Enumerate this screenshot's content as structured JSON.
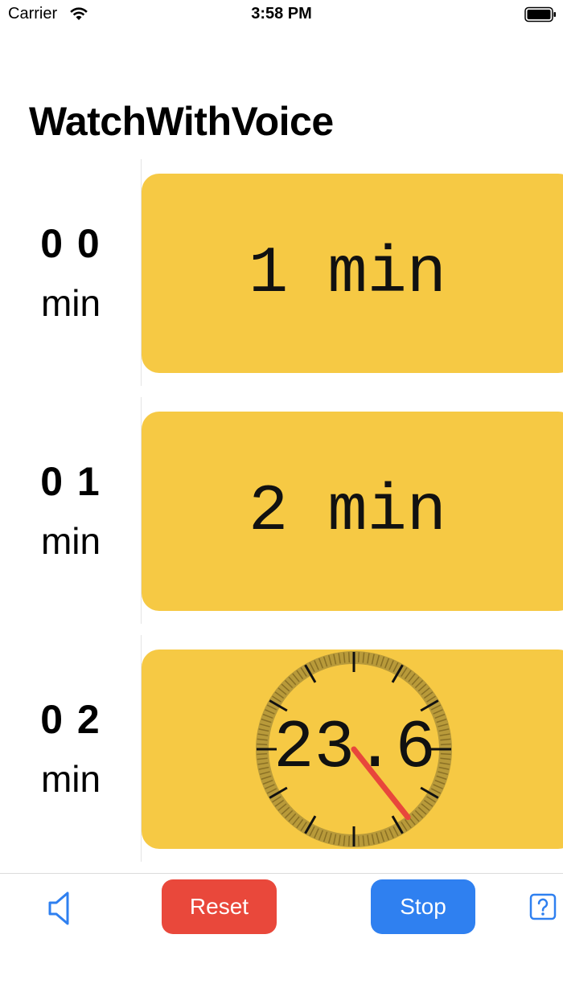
{
  "status_bar": {
    "carrier": "Carrier",
    "time": "3:58 PM",
    "wifi_icon": "wifi-icon",
    "battery_icon": "battery-icon"
  },
  "app": {
    "title": "WatchWithVoice"
  },
  "rows": [
    {
      "number": "0 0",
      "unit": "min",
      "tile_label": "1 min"
    },
    {
      "number": "0 1",
      "unit": "min",
      "tile_label": "2 min"
    },
    {
      "number": "0 2",
      "unit": "min",
      "tile_readout": "23.6"
    }
  ],
  "dial": {
    "seconds": 23.6
  },
  "toolbar": {
    "sound_icon": "speaker-icon",
    "reset_label": "Reset",
    "stop_label": "Stop",
    "help_icon": "question-mark-icon"
  },
  "colors": {
    "tile": "#f6c944",
    "reset": "#e9483b",
    "stop": "#2f80f0",
    "icon_blue": "#2f80f0",
    "hand": "#e8473b"
  }
}
